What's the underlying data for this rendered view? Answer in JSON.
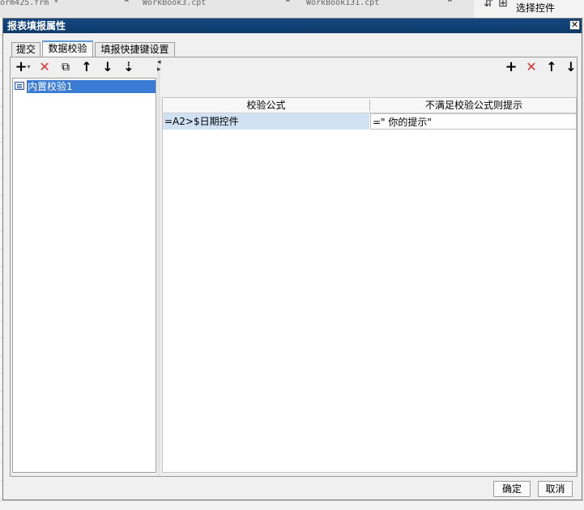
{
  "background": {
    "tab1": "orm425.frm *",
    "tab2": "WorkBook3.cpt",
    "tab3": "WorkBook131.cpt",
    "close_glyph": "×",
    "select_control": "选择控件"
  },
  "dialog": {
    "title": "报表填报属性",
    "close_glyph": "✕",
    "tabs": [
      "提交",
      "数据校验",
      "填报快捷键设置"
    ],
    "active_tab": 1
  },
  "left_toolbar": {
    "icons": [
      "add-dropdown-icon",
      "delete-icon",
      "copy-icon",
      "move-up-icon",
      "move-down-icon",
      "sort-icon"
    ],
    "glyphs": [
      "+",
      "✕",
      "⧉",
      "↑",
      "↓",
      "⇣"
    ]
  },
  "validation_list": {
    "items": [
      "内置校验1"
    ],
    "selected_index": 0
  },
  "right_toolbar": {
    "icons": [
      "add-icon",
      "delete-icon",
      "move-up-icon",
      "move-down-icon"
    ],
    "glyphs": [
      "+",
      "✕",
      "↑",
      "↓"
    ]
  },
  "grid": {
    "columns": [
      "校验公式",
      "不满足校验公式则提示"
    ],
    "rows": [
      [
        "=A2>$日期控件",
        "=\" 你的提示\""
      ]
    ]
  },
  "buttons": {
    "ok": "确定",
    "cancel": "取消"
  },
  "colors": {
    "titlebar": "#0d3a6b",
    "selection": "#3a7bd5",
    "delete_red": "#e0332e",
    "cell_selected": "#cfe1f3"
  }
}
